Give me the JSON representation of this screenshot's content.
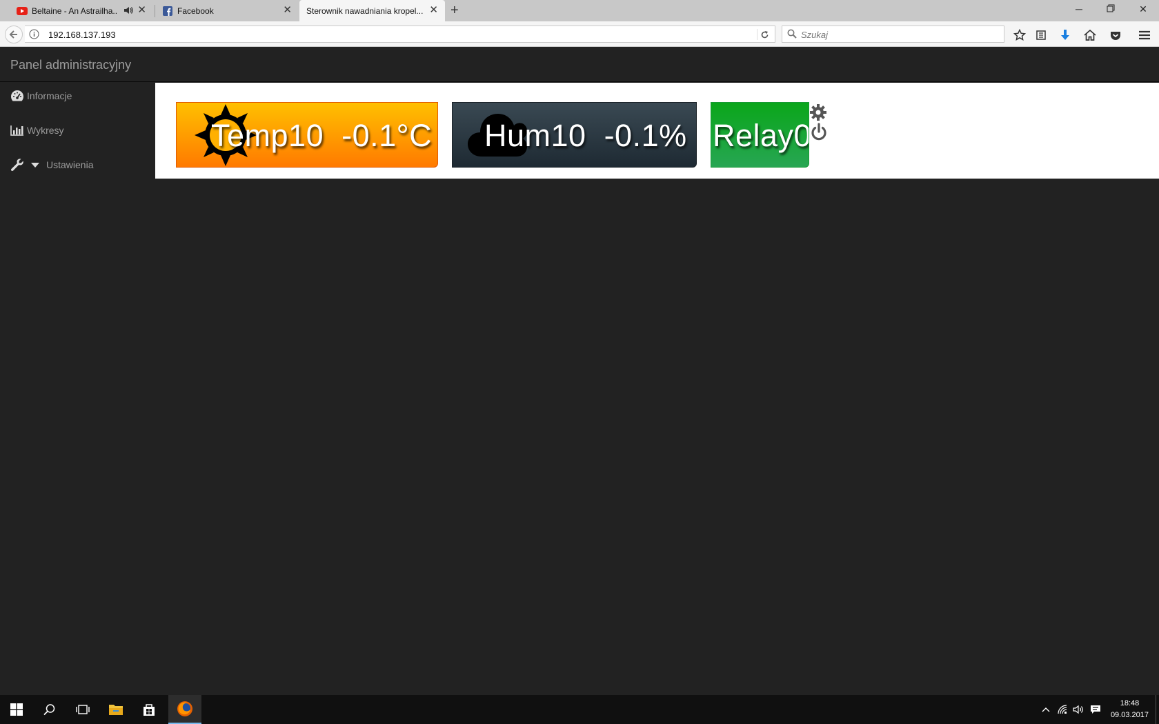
{
  "browser": {
    "tabs": [
      {
        "title": "Beltaine - An Astrailha...",
        "favicon": "youtube-icon",
        "audio": true
      },
      {
        "title": "Facebook",
        "favicon": "facebook-icon"
      },
      {
        "title": "Sterownik nawadniania kropel...",
        "favicon": "none",
        "active": true
      }
    ],
    "url": "192.168.137.193",
    "search_placeholder": "Szukaj"
  },
  "app": {
    "brand": "Panel administracyjny",
    "sidebar": {
      "items": [
        {
          "label": "Informacje",
          "icon": "dashboard-icon"
        },
        {
          "label": "Wykresy",
          "icon": "bar-chart-icon"
        },
        {
          "label": "Ustawienia",
          "icon": "wrench-icon",
          "dropdown": true
        }
      ]
    },
    "tiles": {
      "temp": {
        "label": "Temp10  -0.1°C",
        "icon": "sun-icon",
        "colors": [
          "#ffc000",
          "#ff7a00"
        ]
      },
      "hum": {
        "label": "Hum10  -0.1%",
        "icon": "cloud-icon",
        "colors": [
          "#3a4953",
          "#1e2a33"
        ]
      },
      "relay": {
        "label": "Relay0",
        "icon": "none",
        "colors": [
          "#0aa61a",
          "#27a653"
        ]
      }
    }
  },
  "taskbar": {
    "time": "18:48",
    "date": "09.03.2017"
  }
}
